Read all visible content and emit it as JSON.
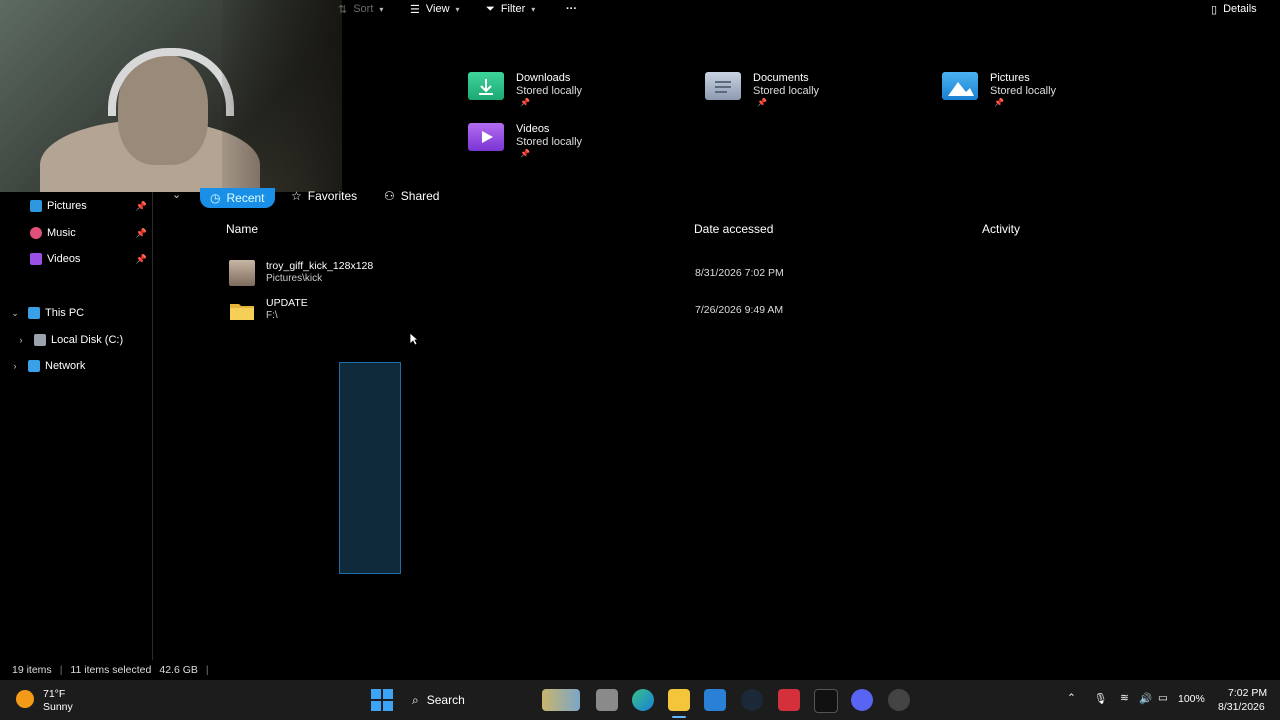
{
  "toolbar": {
    "sort_label": "Sort",
    "view_label": "View",
    "filter_label": "Filter",
    "more_label": "···",
    "details_label": "Details"
  },
  "quick_access": [
    {
      "name": "Downloads",
      "status": "Stored locally",
      "icon": "downloads-folder-icon",
      "color": "#2bbf84"
    },
    {
      "name": "Documents",
      "status": "Stored locally",
      "icon": "documents-folder-icon",
      "color": "#a9b5c8"
    },
    {
      "name": "Pictures",
      "status": "Stored locally",
      "icon": "pictures-folder-icon",
      "color": "#2d97e0"
    },
    {
      "name": "Videos",
      "status": "Stored locally",
      "icon": "videos-folder-icon",
      "color": "#9a50e6"
    }
  ],
  "tabs": [
    {
      "label": "Recent",
      "active": true
    },
    {
      "label": "Favorites",
      "active": false
    },
    {
      "label": "Shared",
      "active": false
    }
  ],
  "sidebar": {
    "items": [
      {
        "label": "Pictures",
        "icon": "pictures-icon",
        "pinned": true
      },
      {
        "label": "Music",
        "icon": "music-icon",
        "pinned": true
      },
      {
        "label": "Videos",
        "icon": "videos-icon",
        "pinned": true
      },
      {
        "label": "This PC",
        "icon": "pc-icon",
        "expanded": true
      },
      {
        "label": "Local Disk (C:)",
        "icon": "disk-icon",
        "expanded": false
      },
      {
        "label": "Network",
        "icon": "network-icon",
        "expanded": false
      }
    ]
  },
  "list": {
    "columns": [
      "Name",
      "Date accessed",
      "Activity"
    ],
    "rows": [
      {
        "name": "troy_giff_kick_128x128",
        "location": "Pictures\\kick",
        "date": "8/31/2026 7:02 PM",
        "icon": "image-thumbnail-icon"
      },
      {
        "name": "UPDATE",
        "location": "F:\\",
        "date": "7/26/2026 9:49 AM",
        "icon": "folder-icon"
      }
    ]
  },
  "status": {
    "items_count": "19 items",
    "selected": "11 items selected",
    "size": "42.6 GB"
  },
  "taskbar": {
    "weather_temp": "71°F",
    "weather_desc": "Sunny",
    "search_label": "Search",
    "battery": "100%",
    "time": "7:02 PM",
    "date": "8/31/2026"
  },
  "colors": {
    "accent": "#1a8fe8",
    "background": "#000000",
    "taskbar": "#1c1c1c"
  }
}
